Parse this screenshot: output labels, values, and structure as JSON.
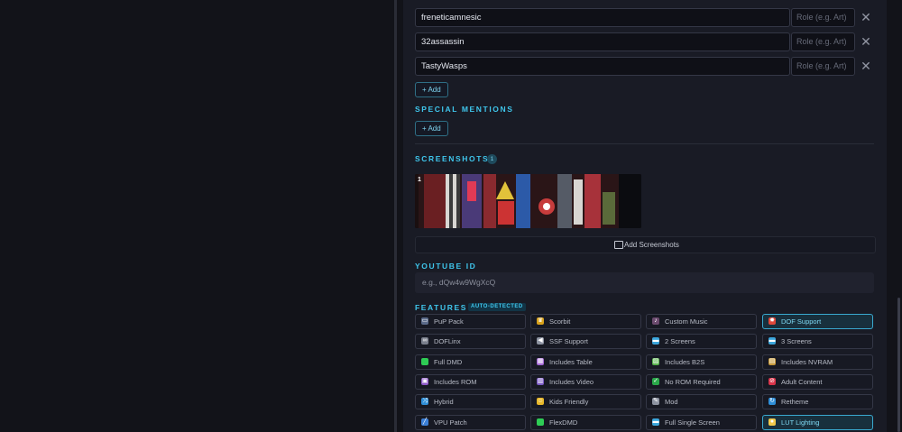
{
  "credits": {
    "rows": [
      {
        "name": "freneticamnesic",
        "role_placeholder": "Role (e.g. Art)",
        "remove": "✕"
      },
      {
        "name": "32assassin",
        "role_placeholder": "Role (e.g. Art)",
        "remove": "✕"
      },
      {
        "name": "TastyWasps",
        "role_placeholder": "Role (e.g. Art)",
        "remove": "✕"
      }
    ],
    "add_label": "+ Add"
  },
  "special_mentions": {
    "title": "SPECIAL MENTIONS",
    "add_label": "+ Add"
  },
  "screenshots": {
    "title": "SCREENSHOTS",
    "count": "1",
    "items": [
      {
        "index": "1"
      }
    ],
    "add_label": "Add Screenshots"
  },
  "youtube": {
    "title": "YOUTUBE ID",
    "placeholder": "e.g., dQw4w9WgXcQ"
  },
  "features": {
    "title": "FEATURES",
    "badge": "AUTO-DETECTED",
    "items": [
      {
        "label": "PuP Pack",
        "icon": "screen-icon",
        "color": "#5b6b8a",
        "active": false
      },
      {
        "label": "Scorbit",
        "icon": "trophy-icon",
        "color": "#d9a21b",
        "active": false
      },
      {
        "label": "Custom Music",
        "icon": "music-icon",
        "color": "#6b4a6e",
        "active": false
      },
      {
        "label": "DOF Support",
        "icon": "burst-icon",
        "color": "#e0483a",
        "active": true
      },
      {
        "label": "DOFLinx",
        "icon": "link-icon",
        "color": "#7a7f8c",
        "active": false
      },
      {
        "label": "SSF Support",
        "icon": "speaker-icon",
        "color": "#8d93a1",
        "active": false
      },
      {
        "label": "2 Screens",
        "icon": "monitor-icon",
        "color": "#3ba6dc",
        "active": false
      },
      {
        "label": "3 Screens",
        "icon": "monitor-icon",
        "color": "#3ba6dc",
        "active": false
      },
      {
        "label": "Full DMD",
        "icon": "green-square-icon",
        "color": "#2ecc55",
        "active": false
      },
      {
        "label": "Includes Table",
        "icon": "table-icon",
        "color": "#a56ad6",
        "active": false
      },
      {
        "label": "Includes B2S",
        "icon": "picture-icon",
        "color": "#58b34d",
        "active": false
      },
      {
        "label": "Includes NVRAM",
        "icon": "filebox-icon",
        "color": "#c79a3c",
        "active": false
      },
      {
        "label": "Includes ROM",
        "icon": "floppy-icon",
        "color": "#8e59c9",
        "active": false
      },
      {
        "label": "Includes Video",
        "icon": "film-icon",
        "color": "#7b5bc4",
        "active": false
      },
      {
        "label": "No ROM Required",
        "icon": "check-icon",
        "color": "#2aa84a",
        "active": false
      },
      {
        "label": "Adult Content",
        "icon": "no-entry-icon",
        "color": "#d8344a",
        "active": false
      },
      {
        "label": "Hybrid",
        "icon": "shuffle-icon",
        "color": "#2f8fd8",
        "active": false
      },
      {
        "label": "Kids Friendly",
        "icon": "smile-icon",
        "color": "#e8b82a",
        "active": false
      },
      {
        "label": "Mod",
        "icon": "wrench-icon",
        "color": "#8d93a1",
        "active": false
      },
      {
        "label": "Retheme",
        "icon": "refresh-icon",
        "color": "#2f8fd8",
        "active": false
      },
      {
        "label": "VPU Patch",
        "icon": "bandage-icon",
        "color": "#3b7fd6",
        "active": false
      },
      {
        "label": "FlexDMD",
        "icon": "green-square-icon",
        "color": "#2ecc55",
        "active": false
      },
      {
        "label": "Full Single Screen",
        "icon": "monitor-icon",
        "color": "#3ba6dc",
        "active": false
      },
      {
        "label": "LUT Lighting",
        "icon": "bulb-icon",
        "color": "#f2c94c",
        "active": true
      }
    ]
  }
}
